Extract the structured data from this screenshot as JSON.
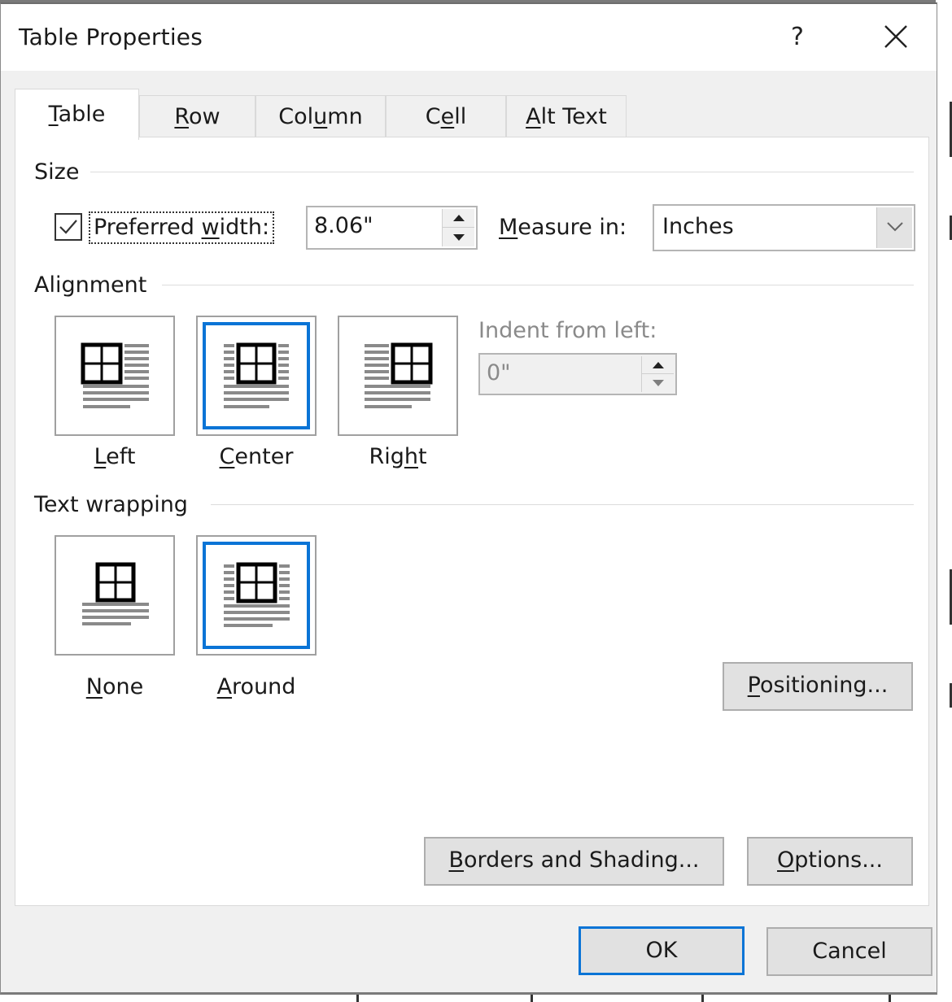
{
  "dialog": {
    "title": "Table Properties",
    "help_label": "?",
    "close_icon": "close-x-icon"
  },
  "tabs": [
    {
      "label": "Table",
      "mnemonic": "T",
      "active": true
    },
    {
      "label": "Row",
      "mnemonic": "R",
      "active": false
    },
    {
      "label": "Column",
      "mnemonic": "u",
      "active": false
    },
    {
      "label": "Cell",
      "mnemonic": "e",
      "active": false
    },
    {
      "label": "Alt Text",
      "mnemonic": "A",
      "active": false
    }
  ],
  "size": {
    "group_label": "Size",
    "preferred_width_checked": true,
    "preferred_width_label_pre": "Preferred ",
    "preferred_width_label_mn": "w",
    "preferred_width_label_post": "idth:",
    "preferred_width_value": "8.06\"",
    "measure_in_label_mn": "M",
    "measure_in_label_post": "easure in:",
    "measure_in_value": "Inches"
  },
  "alignment": {
    "group_label": "Alignment",
    "options": [
      {
        "label_mn": "L",
        "label_post": "eft",
        "icon": "align-left-icon",
        "selected": false
      },
      {
        "label_mn": "C",
        "label_post": "enter",
        "icon": "align-center-icon",
        "selected": true
      },
      {
        "label_pre": "Rig",
        "label_mn": "h",
        "label_post": "t",
        "icon": "align-right-icon",
        "selected": false
      }
    ],
    "indent_label": "Indent from left:",
    "indent_value": "0\"",
    "indent_enabled": false
  },
  "text_wrapping": {
    "group_label": "Text wrapping",
    "options": [
      {
        "label_mn": "N",
        "label_post": "one",
        "icon": "wrap-none-icon",
        "selected": false
      },
      {
        "label_mn": "A",
        "label_post": "round",
        "icon": "wrap-around-icon",
        "selected": true
      }
    ],
    "positioning_label_mn": "P",
    "positioning_label_post": "ositioning..."
  },
  "bottom_buttons": {
    "borders_label_mn": "B",
    "borders_label_post": "orders and Shading...",
    "options_label_mn": "O",
    "options_label_post": "ptions..."
  },
  "footer": {
    "ok_label": "OK",
    "cancel_label": "Cancel"
  },
  "colors": {
    "accent": "#0a74d6",
    "dialog_bg": "#f0f0f0",
    "button_bg": "#e1e1e1"
  }
}
